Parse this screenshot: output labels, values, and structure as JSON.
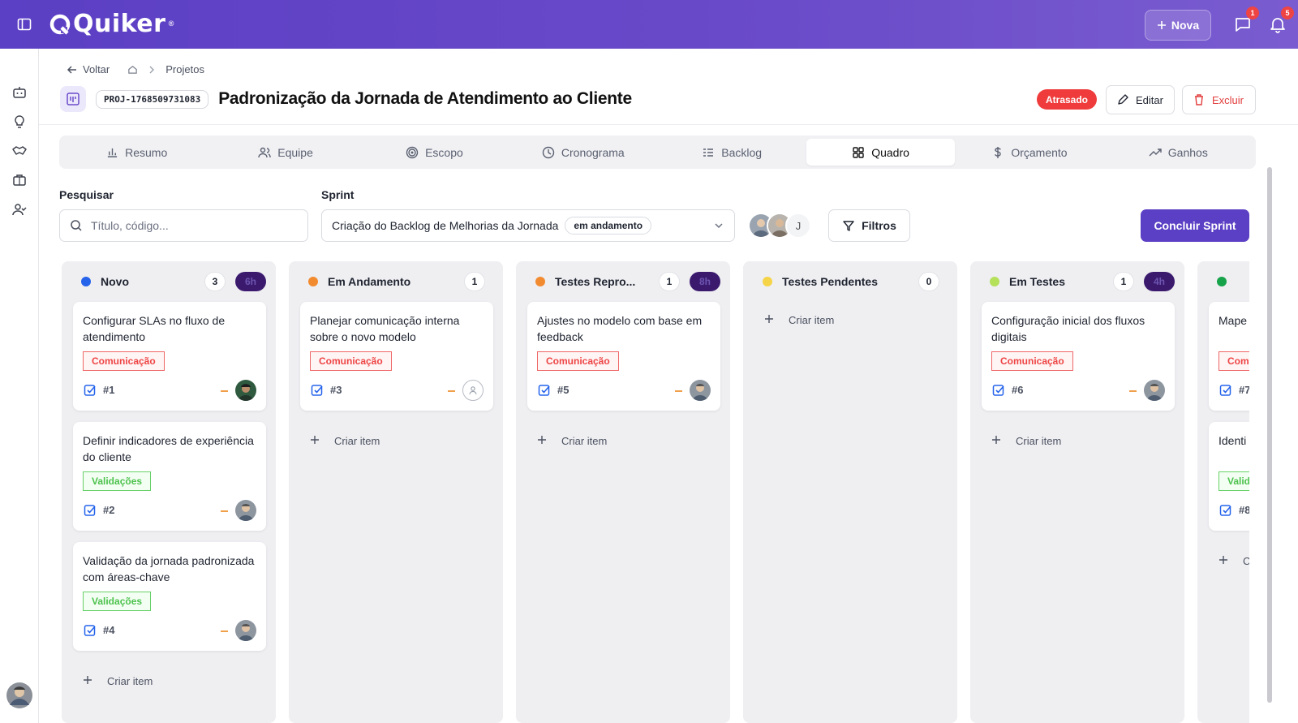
{
  "app": {
    "name": "Quiker",
    "reg": "®"
  },
  "topbar": {
    "new_label": "Nova",
    "messages_badge": "1",
    "notifications_badge": "5"
  },
  "breadcrumb": {
    "back_label": "Voltar",
    "current": "Projetos"
  },
  "project": {
    "code": "PROJ-1768509731083",
    "title": "Padronização da Jornada de Atendimento ao Cliente",
    "status": "Atrasado",
    "edit_label": "Editar",
    "delete_label": "Excluir"
  },
  "tabs": [
    {
      "label": "Resumo",
      "icon": "bar-chart-icon"
    },
    {
      "label": "Equipe",
      "icon": "users-icon"
    },
    {
      "label": "Escopo",
      "icon": "target-icon"
    },
    {
      "label": "Cronograma",
      "icon": "clock-icon"
    },
    {
      "label": "Backlog",
      "icon": "list-icon"
    },
    {
      "label": "Quadro",
      "icon": "grid-icon",
      "active": true
    },
    {
      "label": "Orçamento",
      "icon": "dollar-icon"
    },
    {
      "label": "Ganhos",
      "icon": "trending-up-icon"
    }
  ],
  "filters": {
    "search_label": "Pesquisar",
    "search_placeholder": "Título, código...",
    "sprint_label": "Sprint",
    "sprint_value": "Criação do Backlog de Melhorias da Jornada",
    "sprint_status": "em andamento",
    "avatar_initial": "J",
    "filters_label": "Filtros",
    "conclude_label": "Concluir Sprint"
  },
  "columns": [
    {
      "title": "Novo",
      "color": "#2563eb",
      "count": "3",
      "hours": "6h",
      "cards": [
        {
          "title": "Configurar SLAs no fluxo de atendimento",
          "tag": "Comunicação",
          "tag_type": "com",
          "num": "#1",
          "avatar": "dark"
        },
        {
          "title": "Definir indicadores de experiência do cliente",
          "tag": "Validações",
          "tag_type": "val",
          "num": "#2",
          "avatar": "photo"
        },
        {
          "title": "Validação da jornada padronizada com áreas-chave",
          "tag": "Validações",
          "tag_type": "val",
          "num": "#4",
          "avatar": "photo"
        }
      ],
      "create_label": "Criar item"
    },
    {
      "title": "Em Andamento",
      "color": "#f28b30",
      "count": "1",
      "hours": "",
      "cards": [
        {
          "title": "Planejar comunicação interna sobre o novo modelo",
          "tag": "Comunicação",
          "tag_type": "com",
          "num": "#3",
          "avatar": "empty"
        }
      ],
      "create_label": "Criar item"
    },
    {
      "title": "Testes Repro...",
      "color": "#f28b30",
      "count": "1",
      "hours": "8h",
      "cards": [
        {
          "title": "Ajustes no modelo com base em feedback",
          "tag": "Comunicação",
          "tag_type": "com",
          "num": "#5",
          "avatar": "photo"
        }
      ],
      "create_label": "Criar item"
    },
    {
      "title": "Testes Pendentes",
      "color": "#f5d447",
      "count": "0",
      "hours": "",
      "cards": [],
      "create_label": "Criar item"
    },
    {
      "title": "Em Testes",
      "color": "#b5e05a",
      "count": "1",
      "hours": "4h",
      "cards": [
        {
          "title": "Configuração inicial dos fluxos digitais",
          "tag": "Comunicação",
          "tag_type": "com",
          "num": "#6",
          "avatar": "photo"
        }
      ],
      "create_label": "Criar item"
    },
    {
      "title": "",
      "color": "#16a34a",
      "count": "",
      "hours": "",
      "cards": [
        {
          "title": "Mape",
          "tag": "Com",
          "tag_type": "com",
          "num": "#7",
          "avatar": ""
        },
        {
          "title": "Identi garga",
          "tag": "Valid",
          "tag_type": "val",
          "num": "#8",
          "avatar": ""
        }
      ],
      "create_label": "C"
    }
  ]
}
